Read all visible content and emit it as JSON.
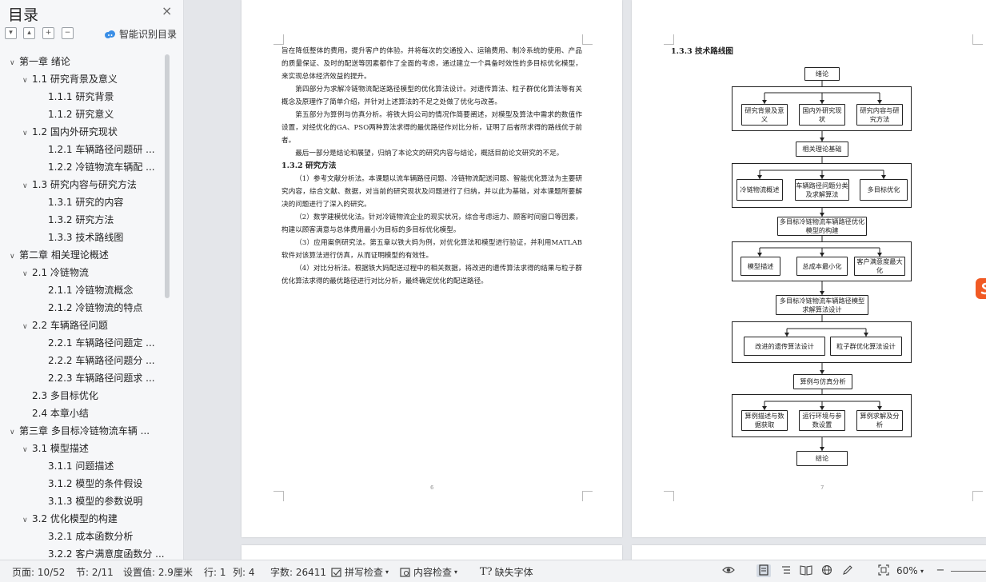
{
  "sidebar": {
    "title": "目录",
    "close_icon": "×",
    "smart_label": "智能识别目录",
    "items": [
      {
        "text": "第一章 绪论",
        "level": 0,
        "expanded": true
      },
      {
        "text": "1.1 研究背景及意义",
        "level": 1,
        "expanded": true
      },
      {
        "text": "1.1.1 研究背景",
        "level": 2
      },
      {
        "text": "1.1.2 研究意义",
        "level": 2
      },
      {
        "text": "1.2 国内外研究现状",
        "level": 1,
        "expanded": true
      },
      {
        "text": "1.2.1 车辆路径问题研 ...",
        "level": 2
      },
      {
        "text": "1.2.2 冷链物流车辆配 ...",
        "level": 2
      },
      {
        "text": "1.3 研究内容与研究方法",
        "level": 1,
        "expanded": true
      },
      {
        "text": "1.3.1 研究的内容",
        "level": 2
      },
      {
        "text": "1.3.2 研究方法",
        "level": 2
      },
      {
        "text": "1.3.3 技术路线图",
        "level": 2
      },
      {
        "text": "第二章 相关理论概述",
        "level": 0,
        "expanded": true
      },
      {
        "text": "2.1 冷链物流",
        "level": 1,
        "expanded": true
      },
      {
        "text": "2.1.1 冷链物流概念",
        "level": 2
      },
      {
        "text": "2.1.2 冷链物流的特点",
        "level": 2
      },
      {
        "text": "2.2 车辆路径问题",
        "level": 1,
        "expanded": true
      },
      {
        "text": "2.2.1 车辆路径问题定 ...",
        "level": 2
      },
      {
        "text": "2.2.2 车辆路径问题分 ...",
        "level": 2
      },
      {
        "text": "2.2.3 车辆路径问题求 ...",
        "level": 2
      },
      {
        "text": "2.3 多目标优化",
        "level": 1
      },
      {
        "text": "2.4 本章小结",
        "level": 1
      },
      {
        "text": "第三章 多目标冷链物流车辆 ...",
        "level": 0,
        "expanded": true
      },
      {
        "text": "3.1 模型描述",
        "level": 1,
        "expanded": true
      },
      {
        "text": "3.1.1 问题描述",
        "level": 2
      },
      {
        "text": "3.1.2 模型的条件假设",
        "level": 2
      },
      {
        "text": "3.1.3 模型的参数说明",
        "level": 2
      },
      {
        "text": "3.2 优化模型的构建",
        "level": 1,
        "expanded": true
      },
      {
        "text": "3.2.1 成本函数分析",
        "level": 2
      },
      {
        "text": "3.2.2 客户满意度函数分 ...",
        "level": 2
      }
    ]
  },
  "page6": {
    "paragraphs": [
      {
        "text": "旨在降低整体的费用，提升客户的体验。并将每次的交通投入、运输费用、制冷系统的使用、产品的质量保证、及时的配送等因素都作了全面的考虑，通过建立一个具备时效性的多目标优化模型，来实现总体经济效益的提升。",
        "indent": false
      },
      {
        "text": "第四部分为求解冷链物流配送路径模型的优化算法设计。对遗传算法、粒子群优化算法等有关概念及原理作了简单介绍，并针对上述算法的不足之处做了优化与改善。",
        "indent": true
      },
      {
        "text": "第五部分为算例与仿真分析。将铁大妈公司的情况作简要阐述，对模型及算法中需求的数值作设置，对经优化的GA、PSO两种算法求得的最优路径作对比分析，证明了后者所求得的路线优于前者。",
        "indent": true
      },
      {
        "text": "最后一部分是结论和展望，归纳了本论文的研究内容与结论，概括目前论文研究的不足。",
        "indent": true
      }
    ],
    "section_heading": "1.3.2 研究方法",
    "method_paragraphs": [
      "（1）参考文献分析法。本课题以流车辆路径问题、冷链物流配送问题、智能优化算法为主要研究内容，综合文献、数据，对当前的研究现状及问题进行了归纳，并以此为基础，对本课题所要解决的问题进行了深入的研究。",
      "（2）数学建模优化法。针对冷链物流企业的现实状况，综合考虑运力、顾客时间窗口等因素，构建以顾客满意与总体费用最小为目标的多目标优化模型。",
      "（3）应用案例研究法。第五章以铁大妈为例，对优化算法和模型进行验证，并利用MATLAB软件对该算法进行仿真，从而证明模型的有效性。",
      "（4）对比分析法。根据铁大妈配送过程中的相关数据，将改进的遗传算法求得的结果与粒子群优化算法求得的最优路径进行对比分析，最终确定优化的配送路径。"
    ],
    "page_number": "6"
  },
  "page7": {
    "heading": "1.3.3 技术路线图",
    "page_number": "7",
    "flow": {
      "start": "绪论",
      "row1": [
        "研究背景及意义",
        "国内外研究现状",
        "研究内容与研究方法"
      ],
      "theory": "相关理论基础",
      "row2": [
        "冷链物流概述",
        "车辆路径问题分类及求解算法",
        "多目标优化"
      ],
      "model": "多目标冷链物流车辆路径优化模型的构建",
      "row3": [
        "模型描述",
        "总成本最小化",
        "客户满意度最大化"
      ],
      "algo": "多目标冷链物流车辆路径模型求解算法设计",
      "row4": [
        "改进的遗传算法设计",
        "粒子群优化算法设计"
      ],
      "case": "算例与仿真分析",
      "row5": [
        "算例描述与数据获取",
        "运行环境与参数设置",
        "算例求解及分析"
      ],
      "end": "结论"
    }
  },
  "status": {
    "page": "页面: 10/52",
    "section": "节: 2/11",
    "setting": "设置值: 2.9厘米",
    "row": "行: 1",
    "col": "列: 4",
    "words": "字数: 26411",
    "spell": "拼写检查",
    "content_check": "内容检查",
    "missing_font": "缺失字体",
    "zoom": "60%"
  },
  "colors": {
    "accent": "#2b6cd4",
    "sogou": "#f15a24"
  }
}
